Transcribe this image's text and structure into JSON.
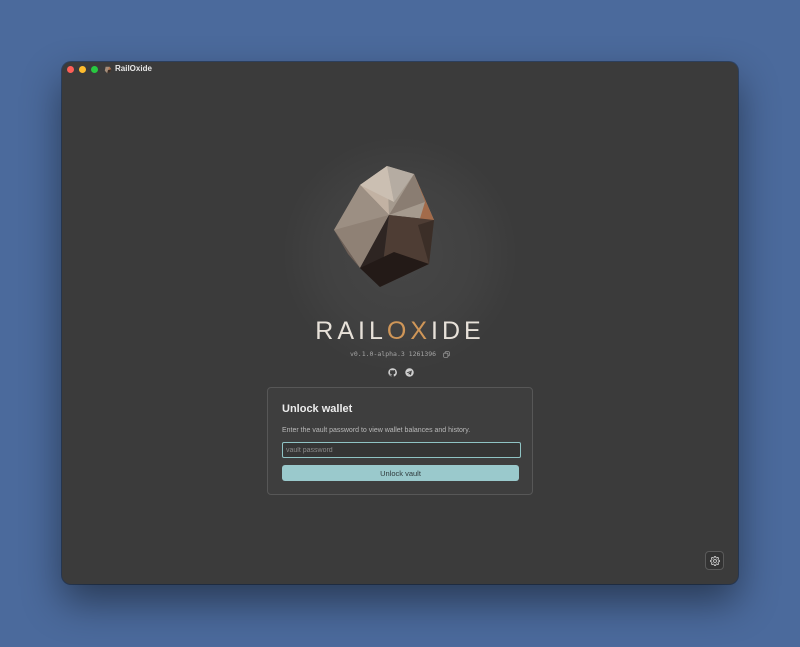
{
  "window": {
    "title": "RailOxide"
  },
  "brand": {
    "name_start": "RAIL",
    "name_accent": "OX",
    "name_end": "IDE",
    "accent_color": "#cf9658"
  },
  "version": {
    "text": "v0.1.0-alpha.3 1261396"
  },
  "icons": {
    "copy": "copy-icon",
    "github": "github-icon",
    "telegram": "telegram-icon",
    "settings": "gear-icon"
  },
  "unlock_card": {
    "title": "Unlock wallet",
    "description": "Enter the vault password to view wallet balances and history.",
    "input_placeholder": "vault password",
    "input_value": "",
    "button_label": "Unlock vault"
  }
}
